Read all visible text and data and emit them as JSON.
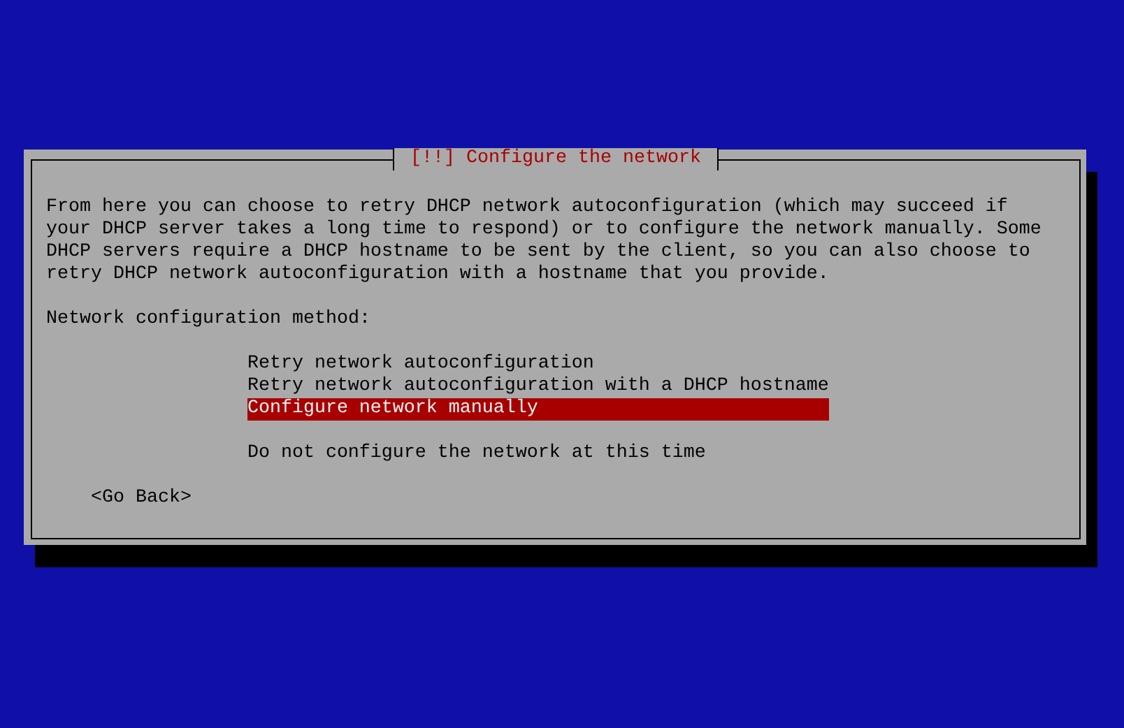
{
  "dialog": {
    "title": "[!!] Configure the network",
    "description": "From here you can choose to retry DHCP network autoconfiguration (which may succeed if your DHCP server takes a long time to respond) or to configure the network manually. Some DHCP servers require a DHCP hostname to be sent by the client, so you can also choose to retry DHCP network autoconfiguration with a hostname that you provide.",
    "prompt": "Network configuration method:",
    "choices": [
      {
        "kind": "option",
        "label": "Retry network autoconfiguration",
        "selected": false
      },
      {
        "kind": "option",
        "label": "Retry network autoconfiguration with a DHCP hostname",
        "selected": false
      },
      {
        "kind": "option",
        "label": "Configure network manually",
        "selected": true
      },
      {
        "kind": "spacer"
      },
      {
        "kind": "option",
        "label": "Do not configure the network at this time",
        "selected": false
      }
    ],
    "buttons": [
      {
        "label": "<Go Back>",
        "selected": false
      }
    ]
  }
}
